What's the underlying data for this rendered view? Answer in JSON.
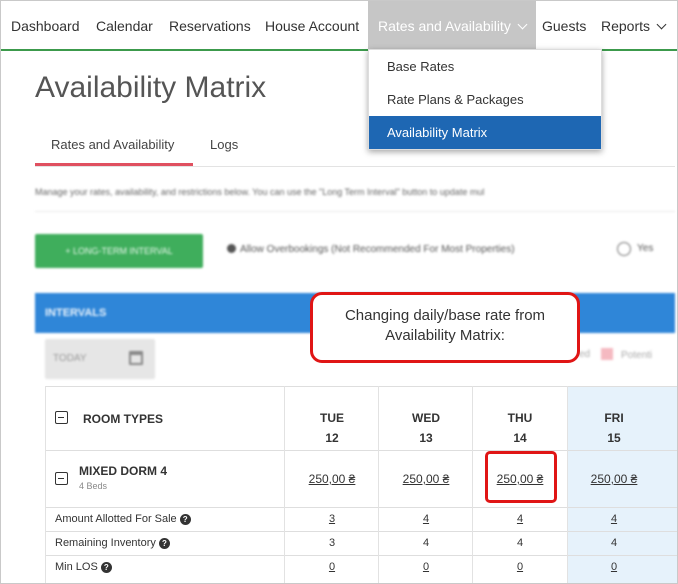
{
  "nav": {
    "items": [
      {
        "label": "Dashboard"
      },
      {
        "label": "Calendar"
      },
      {
        "label": "Reservations"
      },
      {
        "label": "House Account"
      },
      {
        "label": "Rates and Availability"
      },
      {
        "label": "Guests"
      },
      {
        "label": "Reports"
      }
    ]
  },
  "dropdown": {
    "items": [
      {
        "label": "Base Rates"
      },
      {
        "label": "Rate Plans & Packages"
      },
      {
        "label": "Availability Matrix"
      }
    ]
  },
  "page": {
    "title": "Availability Matrix",
    "tabs": [
      {
        "label": "Rates and Availability"
      },
      {
        "label": "Logs"
      }
    ],
    "description": "Manage your rates, availability, and restrictions below. You can use the \"Long Term Interval\" button to update mul",
    "long_term_button": "+ LONG-TERM INTERVAL",
    "overbooking_label": "Allow Overbookings (Not Recommended For Most Properties)",
    "yes_label": "Yes",
    "intervals_label": "INTERVALS",
    "date_placeholder": "TODAY",
    "legend_left": "ed",
    "legend_right": "Potenti"
  },
  "callout": {
    "line1": "Changing daily/base rate from",
    "line2": "Availability Matrix:"
  },
  "table": {
    "header": "ROOM TYPES",
    "days": [
      {
        "dow": "TUE",
        "date": "12"
      },
      {
        "dow": "WED",
        "date": "13"
      },
      {
        "dow": "THU",
        "date": "14"
      },
      {
        "dow": "FRI",
        "date": "15"
      }
    ],
    "room": {
      "name": "MIXED DORM 4",
      "beds": "4 Beds",
      "rates": [
        "250,00 ₴",
        "250,00 ₴",
        "250,00 ₴",
        "250,00 ₴"
      ]
    },
    "rows": [
      {
        "label": "Amount Allotted For Sale",
        "values": [
          "3",
          "4",
          "4",
          "4"
        ]
      },
      {
        "label": "Remaining Inventory",
        "values": [
          "3",
          "4",
          "4",
          "4"
        ]
      },
      {
        "label": "Min LOS",
        "values": [
          "0",
          "0",
          "0",
          "0"
        ]
      }
    ]
  },
  "colors": {
    "nav_accent": "#3c9a4c",
    "active_nav_bg": "#c6c6c6",
    "dropdown_selected": "#1e67b3",
    "tab_underline": "#e05060",
    "callout_border": "#e01515",
    "intervals_bar": "#2f86d8",
    "highlight_column": "#e6f2fb"
  }
}
